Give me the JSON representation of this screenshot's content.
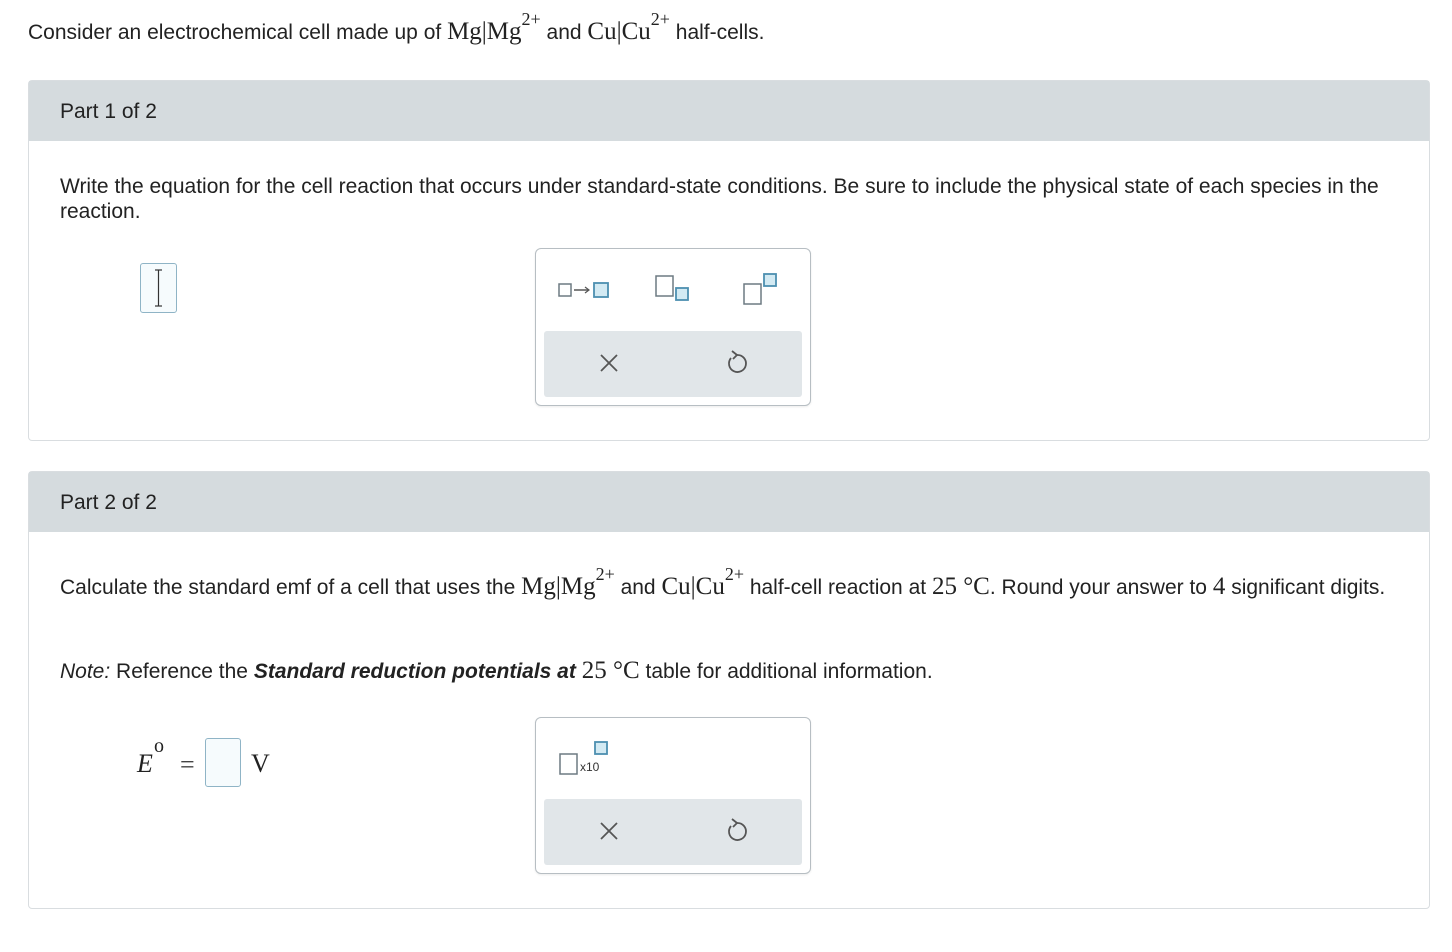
{
  "intro": {
    "prefix": "Consider an electrochemical cell made up of",
    "half1_base": "Mg|Mg",
    "half1_charge": "2+",
    "joiner": "and",
    "half2_base": "Cu|Cu",
    "half2_charge": "2+",
    "suffix": "half-cells."
  },
  "part1": {
    "header": "Part 1 of 2",
    "question": "Write the equation for the cell reaction that occurs under standard-state conditions. Be sure to include the physical state of each species in the reaction.",
    "toolbar": {
      "buttons": [
        "reaction-arrow",
        "subscript",
        "superscript"
      ],
      "clear_symbol": "×",
      "undo_symbol": "↺"
    }
  },
  "part2": {
    "header": "Part 2 of 2",
    "q_prefix": "Calculate the standard emf of a cell that uses the",
    "q_half1_base": "Mg|Mg",
    "q_half1_charge": "2+",
    "q_joiner": "and",
    "q_half2_base": "Cu|Cu",
    "q_half2_charge": "2+",
    "q_mid": "half-cell reaction at",
    "q_temp": "25 °C",
    "q_round": ". Round your answer to",
    "q_digits": "4",
    "q_end": "significant digits.",
    "note_label": "Note:",
    "note_pre": "Reference the",
    "note_bold": "Standard reduction potentials at",
    "note_temp": "25 °C",
    "note_post": "table for additional information.",
    "answer": {
      "symbol": "E",
      "superscript": "o",
      "equals": "=",
      "value": "",
      "unit": "V"
    },
    "toolbar": {
      "sci_label": "x10",
      "clear_symbol": "×",
      "undo_symbol": "↺"
    }
  }
}
